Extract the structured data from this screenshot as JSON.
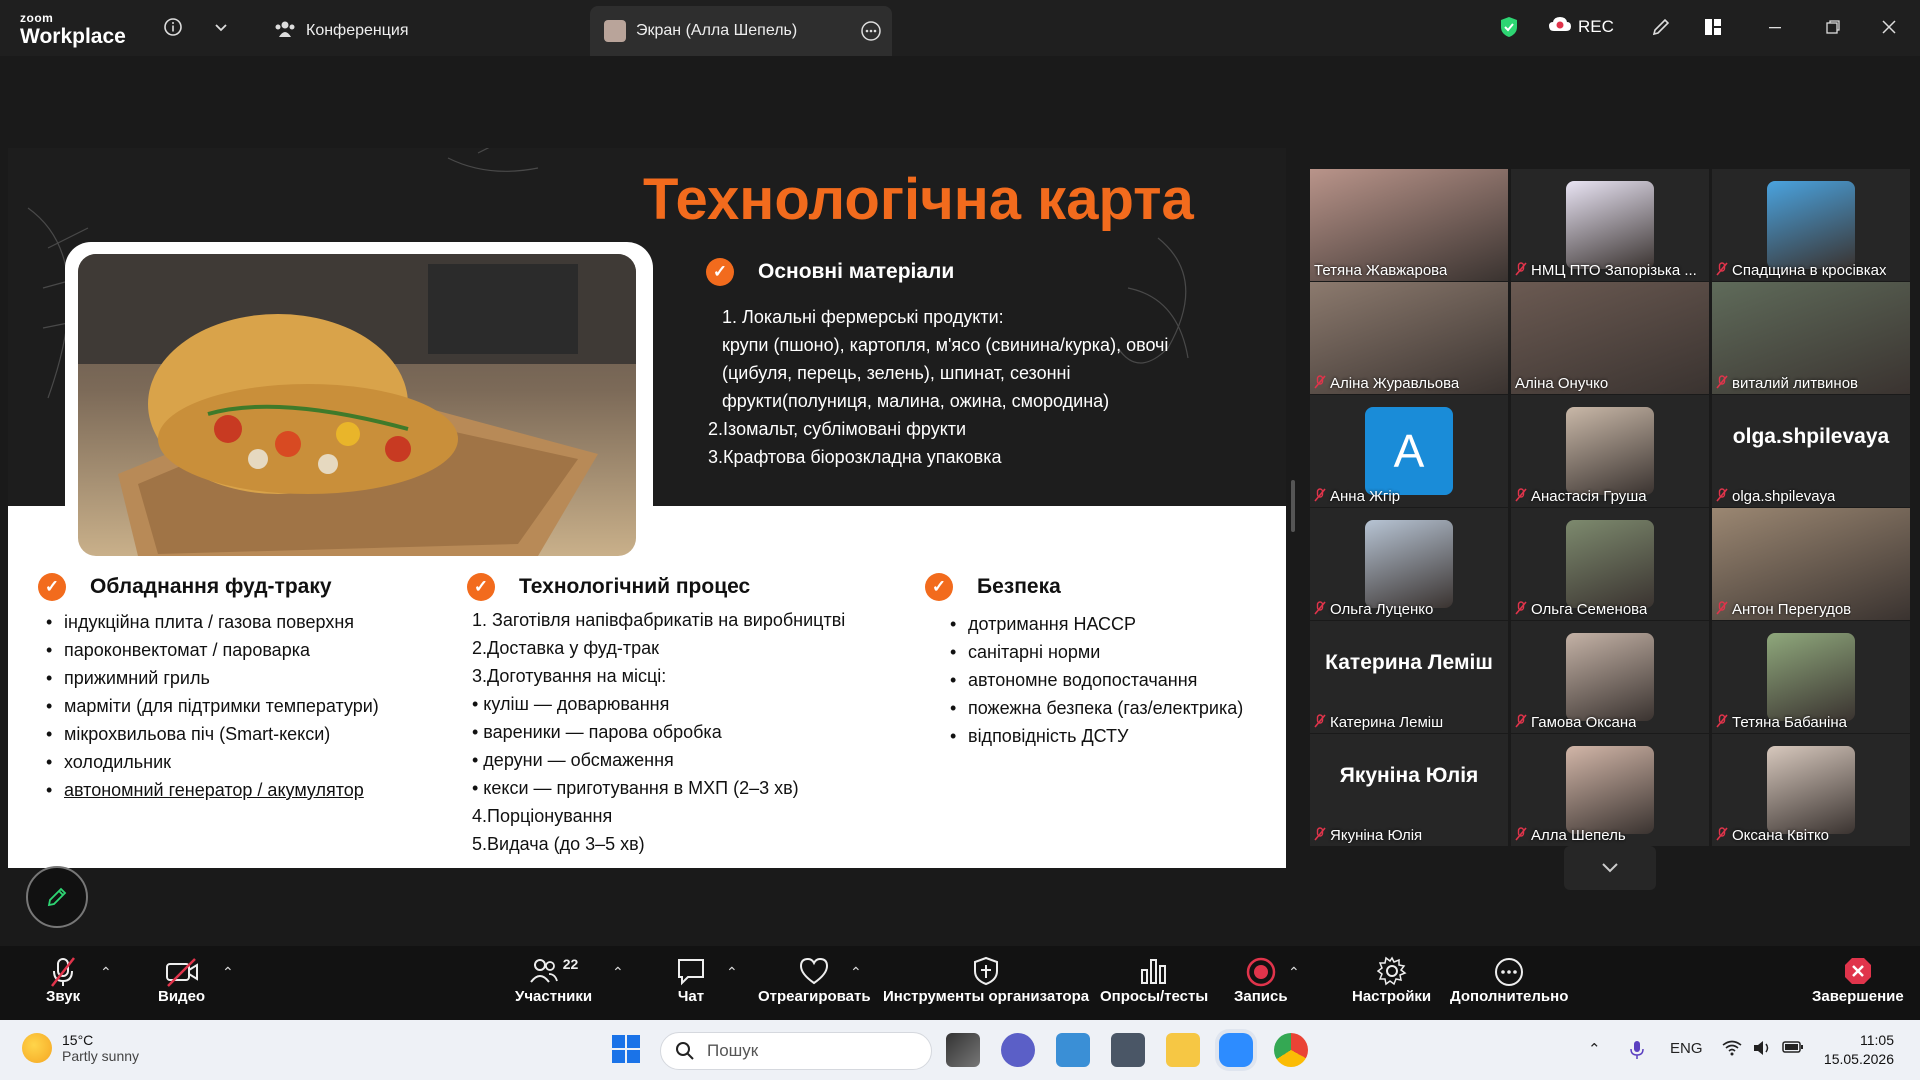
{
  "titlebar": {
    "logo_small": "zoom",
    "logo_big": "Workplace",
    "tab_conference": "Конференция",
    "tab_screen": "Экран (Алла Шепель)",
    "rec_label": "REC"
  },
  "slide": {
    "title": "Технологічна карта",
    "materials_heading": "Основні матеріали",
    "materials": [
      "1. Локальні фермерські продукти:",
      "крупи (пшоно), картопля, м'ясо (свинина/курка), овочі",
      "(цибуля, перець, зелень), шпинат, сезонні",
      "фрукти(полуниця, малина, ожина, смородина)",
      "2.Ізомальт, сублімовані фрукти",
      "3.Крафтова біорозкладна упаковка"
    ],
    "equipment_heading": "Обладнання фуд-траку",
    "equipment": [
      "індукційна плита / газова поверхня",
      "пароконвектомат / пароварка",
      "прижимний гриль",
      "марміти (для підтримки температури)",
      "мікрохвильова піч (Smart-кекси)",
      "холодильник",
      "автономний генератор / акумулятор"
    ],
    "process_heading": "Технологічний процес",
    "process": [
      "1. Заготівля напівфабрикатів на виробництві",
      "2.Доставка у фуд-трак",
      "3.Доготування на місці:",
      "• куліш — доварювання",
      "• вареники — парова обробка",
      "• деруни — обсмаження",
      "• кекси — приготування в МХП (2–3 хв)",
      "4.Порціонування",
      "5.Видача (до 3–5 хв)"
    ],
    "safety_heading": "Безпека",
    "safety": [
      "дотримання НАССР",
      "санітарні норми",
      "автономне водопостачання",
      "пожежна безпека (газ/електрика)",
      "відповідність ДСТУ"
    ]
  },
  "participants": [
    {
      "name": "Тетяна Жавжарова",
      "muted": false,
      "style": "photo",
      "color": "#b9948a"
    },
    {
      "name": "НМЦ ПТО Запорізька ...",
      "muted": true,
      "style": "avatar",
      "color": "#e9e4f4"
    },
    {
      "name": "Спадщина в кросівках",
      "muted": true,
      "style": "avatar",
      "color": "#4aa3df"
    },
    {
      "name": "Аліна Журавльова",
      "muted": true,
      "style": "photo",
      "color": "#8c7a6e"
    },
    {
      "name": "Аліна Онучко",
      "muted": false,
      "style": "photo",
      "color": "#6b5a52",
      "active": true
    },
    {
      "name": "виталий литвинов",
      "muted": true,
      "style": "photo",
      "color": "#5f6b5a"
    },
    {
      "name": "Анна Жгір",
      "muted": true,
      "style": "letter",
      "color": "#1a8cd8",
      "letter": "A"
    },
    {
      "name": "Анастасія Груша",
      "muted": true,
      "style": "avatar",
      "color": "#c9b8a8"
    },
    {
      "name": "olga.shpilevaya",
      "muted": true,
      "style": "text",
      "bigname": "olga.shpilevaya"
    },
    {
      "name": "Ольга Луценко",
      "muted": true,
      "style": "avatar",
      "color": "#b7c4d4"
    },
    {
      "name": "Ольга Семенова",
      "muted": true,
      "style": "avatar",
      "color": "#7d8a6e"
    },
    {
      "name": "Антон Перегудов",
      "muted": true,
      "style": "photo",
      "color": "#9b8772"
    },
    {
      "name": "Катерина Леміш",
      "muted": true,
      "style": "text",
      "bigname": "Катерина Леміш"
    },
    {
      "name": "Гамова Оксана",
      "muted": true,
      "style": "avatar",
      "color": "#c4b2a6"
    },
    {
      "name": "Тетяна Бабаніна",
      "muted": true,
      "style": "avatar",
      "color": "#8fa87c"
    },
    {
      "name": "Якуніна Юлія",
      "muted": true,
      "style": "text",
      "bigname": "Якуніна Юлія"
    },
    {
      "name": "Алла Шепель",
      "muted": true,
      "style": "avatar",
      "color": "#d2b6a8"
    },
    {
      "name": "Оксана Квітко",
      "muted": true,
      "style": "avatar",
      "color": "#d7c8bd"
    }
  ],
  "toolbar": {
    "audio": "Звук",
    "video": "Видео",
    "participants": "Участники",
    "participants_count": "22",
    "chat": "Чат",
    "react": "Отреагировать",
    "host_tools": "Инструменты организатора",
    "polls": "Опросы/тесты",
    "record": "Запись",
    "settings": "Настройки",
    "more": "Дополнительно",
    "end": "Завершение"
  },
  "taskbar": {
    "temp": "15°C",
    "weather": "Partly sunny",
    "search_placeholder": "Пошук",
    "lang": "ENG",
    "time": "11:05",
    "date": "15.05.2026"
  },
  "colors": {
    "accent_orange": "#f26b1d",
    "active_speaker": "#2ed573",
    "mic_muted": "#e0344b"
  }
}
